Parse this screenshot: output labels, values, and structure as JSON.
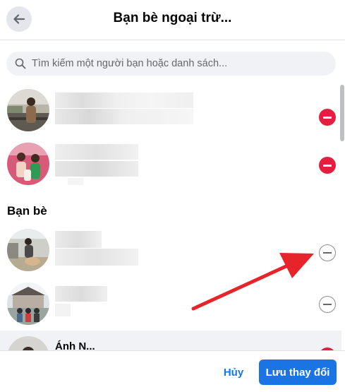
{
  "header": {
    "title": "Bạn bè ngoại trừ...",
    "back_icon": "arrow-left-icon"
  },
  "search": {
    "placeholder": "Tìm kiếm một người bạn hoặc danh sách..."
  },
  "excluded": [
    {
      "name": "",
      "status": "excluded"
    },
    {
      "name": "",
      "status": "excluded"
    }
  ],
  "friends_section": {
    "title": "Bạn bè"
  },
  "friends": [
    {
      "name": "",
      "status": "not-excluded"
    },
    {
      "name": "",
      "status": "not-excluded"
    },
    {
      "name": "Ánh N...",
      "status": "excluded"
    }
  ],
  "footer": {
    "cancel_label": "Hủy",
    "save_label": "Lưu thay đổi"
  },
  "colors": {
    "accent": "#1b74e4",
    "remove": "#e41e3f",
    "annotation_arrow": "#e8242b"
  }
}
